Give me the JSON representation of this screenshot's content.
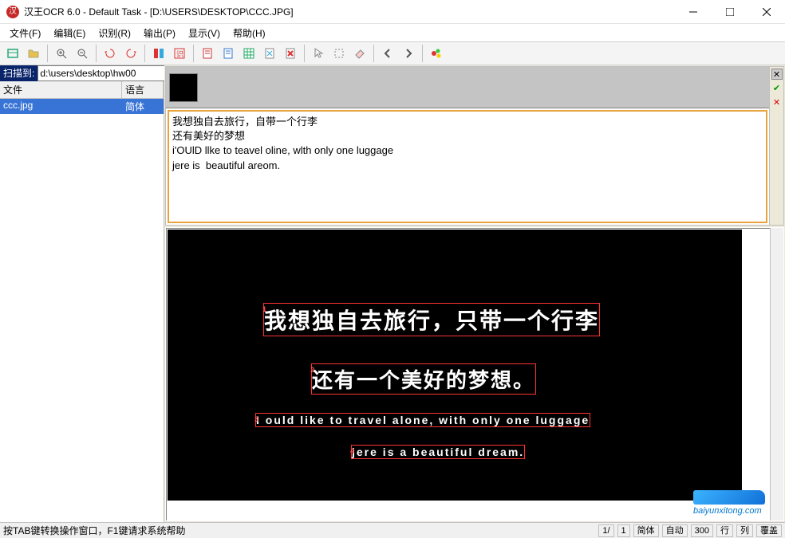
{
  "window": {
    "title": "汉王OCR 6.0 - Default Task - [D:\\USERS\\DESKTOP\\CCC.JPG]"
  },
  "menu": {
    "file": "文件(F)",
    "edit": "编辑(E)",
    "recognize": "识别(R)",
    "output": "输出(P)",
    "view": "显示(V)",
    "help": "帮助(H)"
  },
  "sidebar": {
    "scan_label": "扫描到:",
    "scan_path": "d:\\users\\desktop\\hw00",
    "col_file": "文件",
    "col_lang": "语言",
    "files": [
      {
        "name": "ccc.jpg",
        "lang": "简体"
      }
    ]
  },
  "ocr_result": {
    "lines": [
      "我想独自去旅行，自带一个行李",
      "还有美好的梦想",
      "i'OUlD llke to teavel oline, wlth only one luggage",
      "jere is  beautiful areom."
    ]
  },
  "image_text": {
    "l1": "我想独自去旅行，只带一个行李",
    "l2": "还有一个美好的梦想。",
    "l3": "I  ould like to travel alone, with only one luggage",
    "l4": " jere is a beautiful dream."
  },
  "watermark": {
    "url": "baiyunxitong.com"
  },
  "status": {
    "help": "按TAB键转换操作窗口，F1键请求系统帮助",
    "page": "1/",
    "total": "1",
    "lang": "简体",
    "auto": "自动",
    "zoom": "300",
    "row": "行",
    "col": "列",
    "mode": "覆盖"
  }
}
